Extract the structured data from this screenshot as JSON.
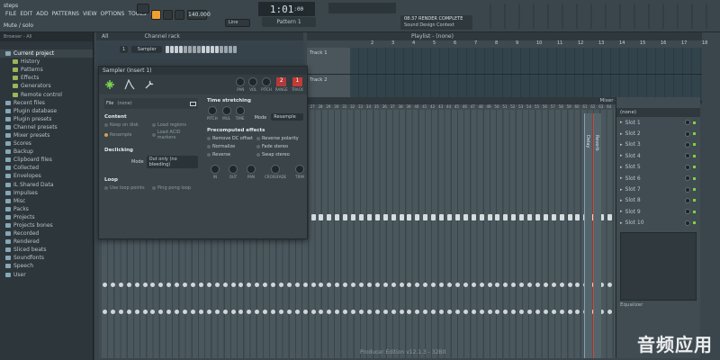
{
  "title_bar": {
    "song_name": "steps"
  },
  "menu": [
    "FILE",
    "EDIT",
    "ADD",
    "PATTERNS",
    "VIEW",
    "OPTIONS",
    "TOOLS",
    "?"
  ],
  "hint_bar": "Mute / solo",
  "transport": {
    "time": "1:01",
    "time_sub": ":00",
    "tempo": "140.000",
    "pattern": "Pattern 1",
    "snap": "Line"
  },
  "render_panel": {
    "line1": "08:37 RENDER COMPLETE",
    "line2": "Sound Design Context"
  },
  "browser": {
    "header": "Browser - All",
    "items": [
      {
        "label": "Current project",
        "sub": false,
        "active": true
      },
      {
        "label": "History",
        "sub": true
      },
      {
        "label": "Patterns",
        "sub": true
      },
      {
        "label": "Effects",
        "sub": true
      },
      {
        "label": "Generators",
        "sub": true
      },
      {
        "label": "Remote control",
        "sub": true
      },
      {
        "label": "Recent files",
        "sub": false
      },
      {
        "label": "Plugin database",
        "sub": false
      },
      {
        "label": "Plugin presets",
        "sub": false
      },
      {
        "label": "Channel presets",
        "sub": false
      },
      {
        "label": "Mixer presets",
        "sub": false
      },
      {
        "label": "Scores",
        "sub": false
      },
      {
        "label": "Backup",
        "sub": false
      },
      {
        "label": "Clipboard files",
        "sub": false
      },
      {
        "label": "Collected",
        "sub": false
      },
      {
        "label": "Envelopes",
        "sub": false
      },
      {
        "label": "IL Shared Data",
        "sub": false
      },
      {
        "label": "Impulses",
        "sub": false
      },
      {
        "label": "Misc",
        "sub": false
      },
      {
        "label": "Packs",
        "sub": false
      },
      {
        "label": "Projects",
        "sub": false
      },
      {
        "label": "Projects bones",
        "sub": false
      },
      {
        "label": "Recorded",
        "sub": false
      },
      {
        "label": "Rendered",
        "sub": false
      },
      {
        "label": "Sliced beats",
        "sub": false
      },
      {
        "label": "Soundfonts",
        "sub": false
      },
      {
        "label": "Speech",
        "sub": false
      },
      {
        "label": "User",
        "sub": false
      }
    ]
  },
  "channel_rack": {
    "filter": "All",
    "title": "Channel rack",
    "channel_number": "1",
    "channel_name": "Sampler"
  },
  "playlist": {
    "title": "Playlist - (none)",
    "tracks": [
      "Track 1",
      "Track 2"
    ],
    "bars": [
      "2",
      "3",
      "4",
      "5",
      "6",
      "7",
      "8",
      "9",
      "10",
      "11",
      "12",
      "13",
      "14",
      "15",
      "16",
      "17",
      "18"
    ]
  },
  "sampler": {
    "title": "Sampler (Insert 1)",
    "file_label": "File",
    "file_value": "(none)",
    "top_knobs": [
      "PAN",
      "VOL",
      "PITCH",
      "RANGE",
      "TRACK"
    ],
    "range_value": "2",
    "track_value": "1",
    "content_title": "Content",
    "content_opts": [
      "Keep on disk",
      "Load regions",
      "Resample",
      "Load ACID markers"
    ],
    "declicking_title": "Declicking",
    "declick_mode_label": "Mode",
    "declick_mode_value": "Out only (no bleeding)",
    "loop_title": "Loop",
    "loop_opts": [
      "Use loop points",
      "Ping pong loop"
    ],
    "time_title": "Time stretching",
    "time_knobs": [
      "PITCH",
      "MUL",
      "TIME"
    ],
    "time_mode_label": "Mode",
    "time_mode_value": "Resample",
    "precomp_title": "Precomputed effects",
    "precomp_opts": [
      "Remove DC offset",
      "Reverse polarity",
      "Normalize",
      "Fade stereo",
      "Reverse",
      "Swap stereo"
    ],
    "precomp_knobs": [
      "IN",
      "OUT",
      "PAN",
      "CROSSFADE",
      "TRIM"
    ]
  },
  "mixer": {
    "title": "Mixer - Insert 1",
    "channel_numbers": [
      "1",
      "2",
      "3",
      "4",
      "5",
      "6",
      "7",
      "8",
      "9",
      "10",
      "11",
      "12",
      "13",
      "14",
      "15",
      "16",
      "17",
      "18",
      "19",
      "20",
      "21",
      "22",
      "23",
      "24",
      "25",
      "26",
      "27",
      "28",
      "29",
      "30",
      "31",
      "32",
      "33",
      "34",
      "35",
      "36",
      "37",
      "38",
      "39",
      "40",
      "41",
      "42",
      "43",
      "44",
      "45",
      "46",
      "47",
      "48",
      "49",
      "50",
      "51",
      "52",
      "53",
      "54",
      "55",
      "56",
      "57",
      "58",
      "59",
      "60",
      "61",
      "62",
      "63",
      "64"
    ],
    "send_labels": [
      "Delay",
      "Reverb"
    ],
    "insert_preset": "(none)",
    "slots": [
      "Slot 1",
      "Slot 2",
      "Slot 3",
      "Slot 4",
      "Slot 5",
      "Slot 6",
      "Slot 7",
      "Slot 8",
      "Slot 9",
      "Slot 10"
    ],
    "equalizer_label": "Equalizer",
    "footer": "Producer Edition v12.1.3 - 32Bit"
  },
  "watermark": "音频应用"
}
